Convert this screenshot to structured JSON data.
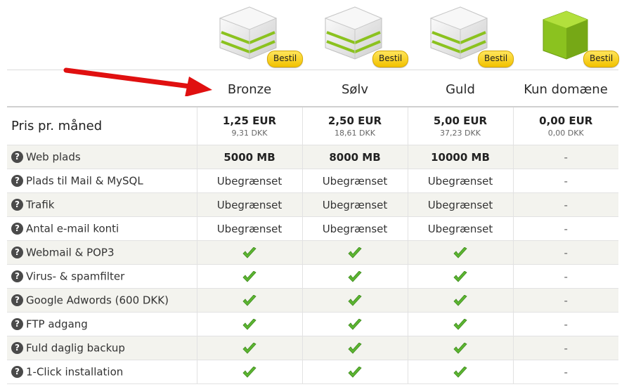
{
  "plans": [
    {
      "name": "Bronze",
      "order_label": "Bestil",
      "icon": "server-stack-icon",
      "price_eur": "1,25 EUR",
      "price_dkk": "9,31 DKK"
    },
    {
      "name": "Sølv",
      "order_label": "Bestil",
      "icon": "server-stack-icon",
      "price_eur": "2,50 EUR",
      "price_dkk": "18,61 DKK"
    },
    {
      "name": "Guld",
      "order_label": "Bestil",
      "icon": "server-stack-icon",
      "price_eur": "5,00 EUR",
      "price_dkk": "37,23 DKK"
    },
    {
      "name": "Kun domæne",
      "order_label": "Bestil",
      "icon": "green-cube-icon",
      "price_eur": "0,00 EUR",
      "price_dkk": "0,00 DKK"
    }
  ],
  "price_row_label": "Pris pr. måned",
  "help_icon": "question-icon",
  "colors": {
    "accent_green": "#8bc21f",
    "badge_yellow": "#f5cd1a",
    "arrow_red": "#e01010",
    "stripe": "#f3f3ee"
  },
  "features": [
    {
      "label": "Web plads",
      "values": [
        "5000 MB",
        "8000 MB",
        "10000 MB",
        "-"
      ]
    },
    {
      "label": "Plads til Mail & MySQL",
      "values": [
        "Ubegrænset",
        "Ubegrænset",
        "Ubegrænset",
        "-"
      ]
    },
    {
      "label": "Trafik",
      "values": [
        "Ubegrænset",
        "Ubegrænset",
        "Ubegrænset",
        "-"
      ]
    },
    {
      "label": "Antal e-mail konti",
      "values": [
        "Ubegrænset",
        "Ubegrænset",
        "Ubegrænset",
        "-"
      ]
    },
    {
      "label": "Webmail & POP3",
      "values": [
        "check",
        "check",
        "check",
        "-"
      ]
    },
    {
      "label": "Virus- & spamfilter",
      "values": [
        "check",
        "check",
        "check",
        "-"
      ]
    },
    {
      "label": "Google Adwords (600 DKK)",
      "values": [
        "check",
        "check",
        "check",
        "-"
      ]
    },
    {
      "label": "FTP adgang",
      "values": [
        "check",
        "check",
        "check",
        "-"
      ]
    },
    {
      "label": "Fuld daglig backup",
      "values": [
        "check",
        "check",
        "check",
        "-"
      ]
    },
    {
      "label": "1-Click installation",
      "values": [
        "check",
        "check",
        "check",
        "-"
      ]
    }
  ]
}
